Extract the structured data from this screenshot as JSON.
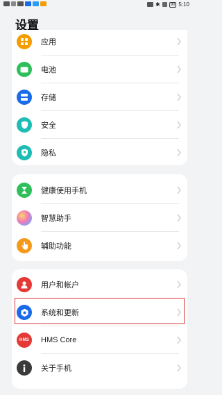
{
  "status_bar": {
    "time": "5:10",
    "battery": "90"
  },
  "page_title": "设置",
  "groups": [
    {
      "items": [
        {
          "label": "应用",
          "icon": "apps-icon",
          "color": "#f59d00"
        },
        {
          "label": "电池",
          "icon": "battery-icon",
          "color": "#2fbf5a"
        },
        {
          "label": "存储",
          "icon": "storage-icon",
          "color": "#1a6bea"
        },
        {
          "label": "安全",
          "icon": "shield-icon",
          "color": "#1dbcb5"
        },
        {
          "label": "隐私",
          "icon": "privacy-icon",
          "color": "#1dbcb5"
        }
      ]
    },
    {
      "items": [
        {
          "label": "健康使用手机",
          "icon": "hourglass-icon",
          "color": "#2fbf5a"
        },
        {
          "label": "智慧助手",
          "icon": "assistant-icon",
          "color": "#b57cf0"
        },
        {
          "label": "辅助功能",
          "icon": "hand-icon",
          "color": "#f39a1c"
        }
      ]
    },
    {
      "items": [
        {
          "label": "用户和帐户",
          "icon": "user-icon",
          "color": "#e53935"
        },
        {
          "label": "系统和更新",
          "icon": "system-gear-icon",
          "color": "#1a6bea"
        },
        {
          "label": "HMS Core",
          "icon": "hms-icon",
          "color": "#e53935",
          "icon_text": "HMS"
        },
        {
          "label": "关于手机",
          "icon": "info-icon",
          "color": "#3a3a3a"
        }
      ]
    }
  ],
  "highlighted_item": "系统和更新"
}
